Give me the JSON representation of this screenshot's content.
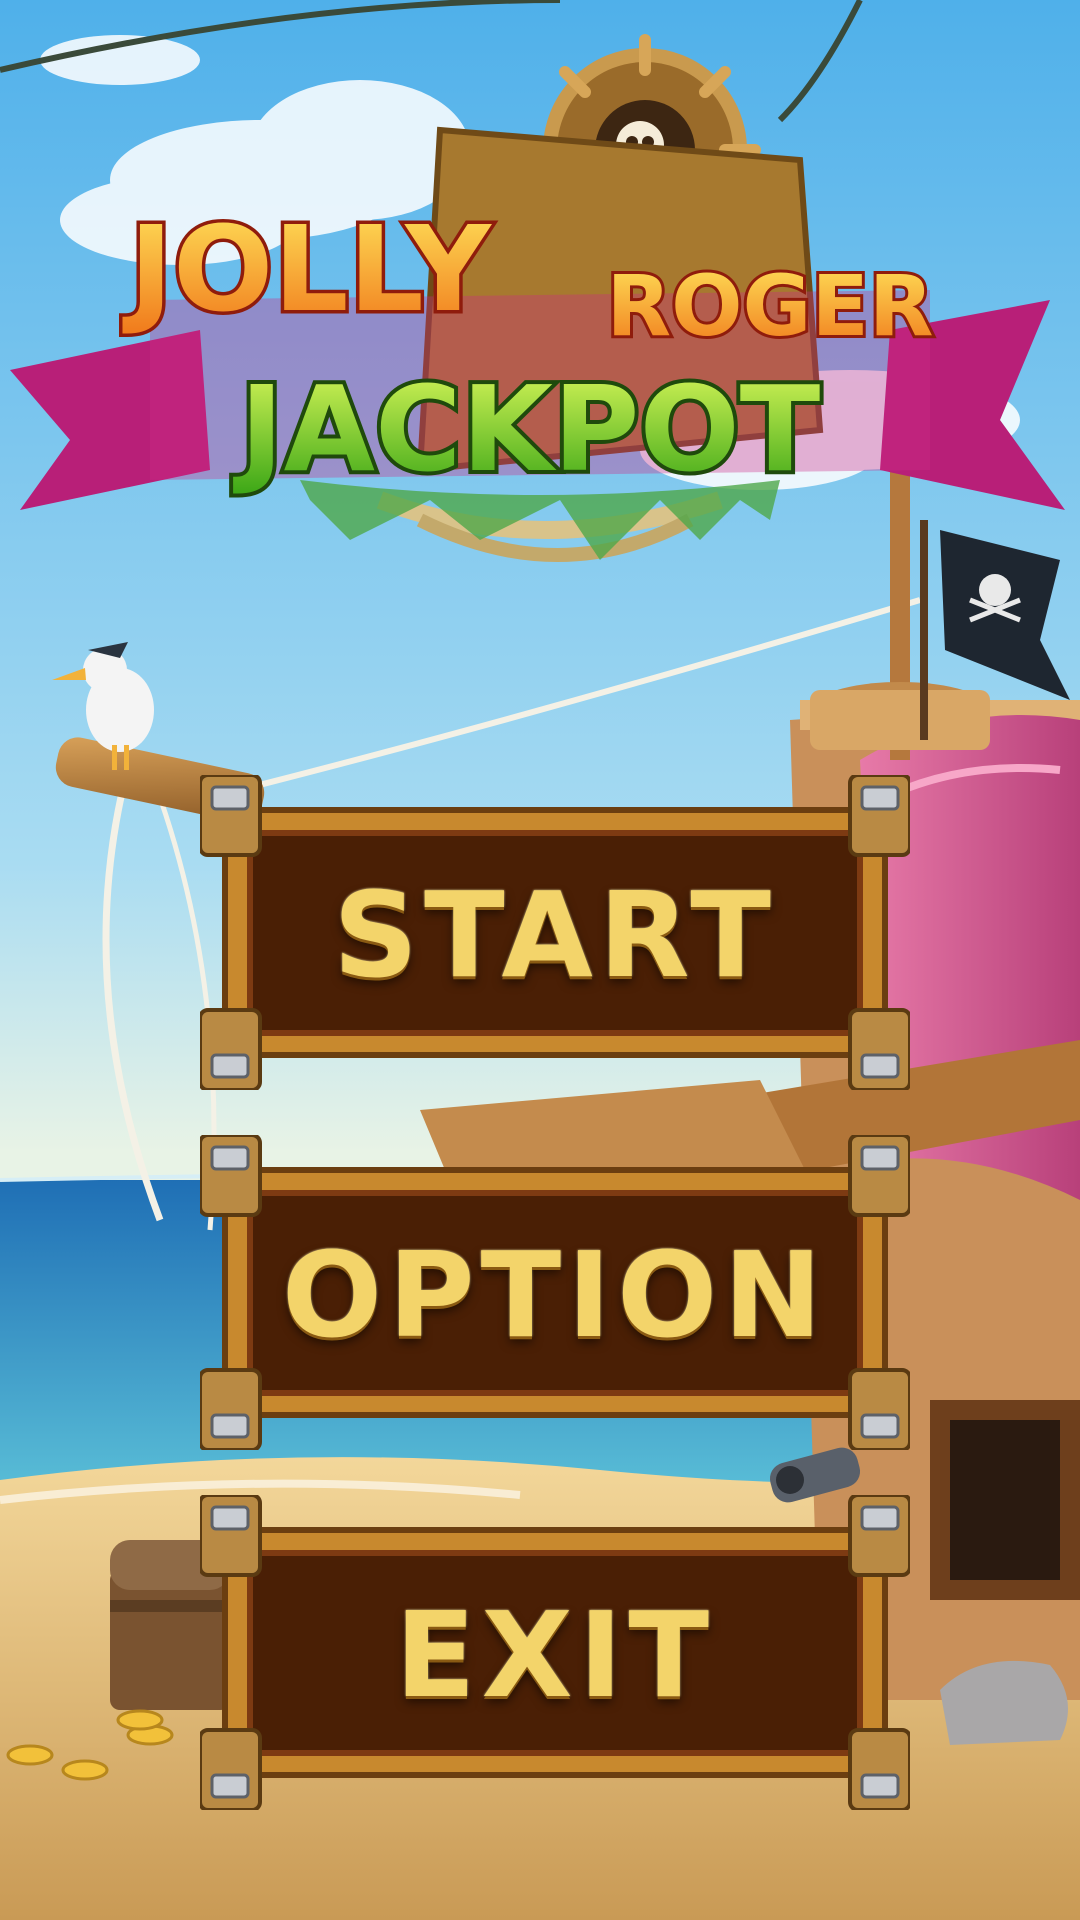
{
  "game": {
    "title_line1a": "JOLLY",
    "title_line1b": "ROGER",
    "title_line2": "JACKPOT"
  },
  "menu": {
    "start_label": "START",
    "option_label": "OPTION",
    "exit_label": "EXIT"
  },
  "colors": {
    "sky_top": "#5fb6e8",
    "sea": "#2f7fc0",
    "sand": "#e8c27a",
    "button_panel": "#4a1f05",
    "button_frame": "#c8892e",
    "button_text": "#f3d46a",
    "banner_pink": "#c2237e",
    "title_orange": "#f29a1c",
    "title_green": "#7ccf1f"
  },
  "icons": [
    "ship-wheel-icon",
    "skull-crossbones-icon",
    "pirate-flag-icon",
    "seagull-icon",
    "treasure-chest-icon",
    "gold-coin-icon",
    "cannon-icon"
  ]
}
